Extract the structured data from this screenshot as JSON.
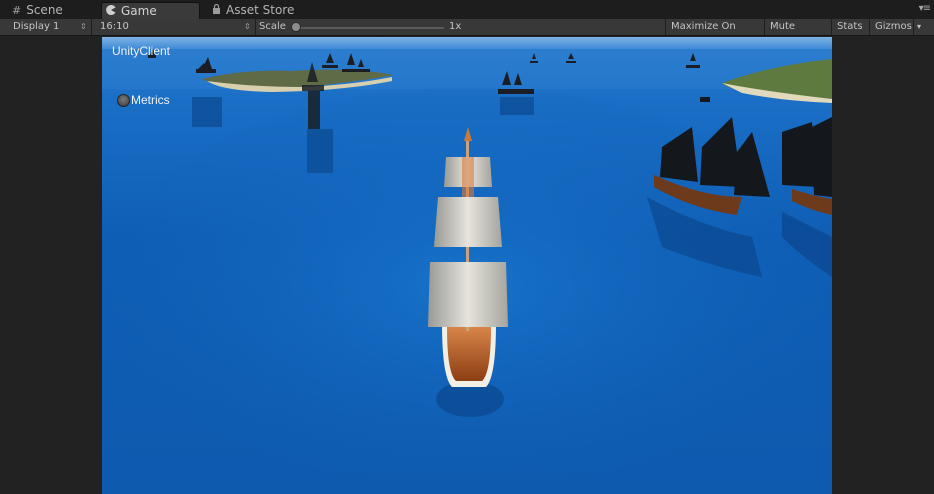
{
  "tabs": [
    {
      "label": "Scene",
      "icon": "grid-icon"
    },
    {
      "label": "Game",
      "icon": "pacman-icon",
      "active": true
    },
    {
      "label": "Asset Store",
      "icon": "lock-icon"
    }
  ],
  "toolbar": {
    "display": "Display 1",
    "aspect": "16:10",
    "scale_label": "Scale",
    "scale_value": "1x",
    "maximize_on_play": "Maximize On Play",
    "mute_audio": "Mute Audio",
    "stats": "Stats",
    "gizmos": "Gizmos"
  },
  "game": {
    "client_label": "UnityClient",
    "metrics_label": "Metrics"
  },
  "colors": {
    "ocean": "#0f5eb6",
    "panel": "#383838",
    "tab_bg": "#1d1d1d"
  }
}
